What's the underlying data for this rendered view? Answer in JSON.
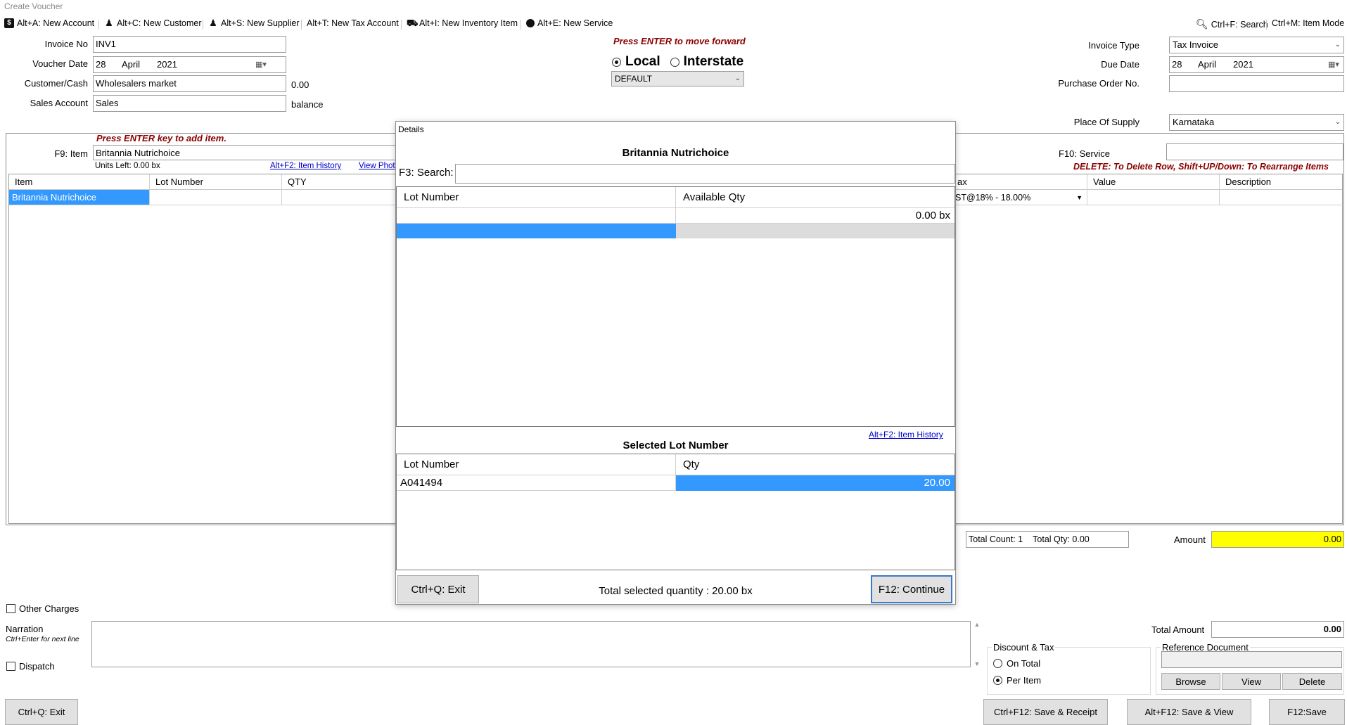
{
  "window": {
    "title": "Create Voucher"
  },
  "toolbar": {
    "items": [
      {
        "icon": "account-icon",
        "label": "Alt+A: New Account"
      },
      {
        "icon": "customer-icon",
        "label": "Alt+C: New Customer"
      },
      {
        "icon": "supplier-icon",
        "label": "Alt+S: New Supplier"
      },
      {
        "icon": "",
        "label": "Alt+T: New Tax Account"
      },
      {
        "icon": "inventory-icon",
        "label": "Alt+I: New Inventory Item"
      },
      {
        "icon": "service-icon",
        "label": "Alt+E: New Service"
      }
    ],
    "search": "Ctrl+F: Search",
    "item_mode": "Ctrl+M: Item Mode"
  },
  "header": {
    "invoice_no_label": "Invoice No",
    "invoice_no": "INV1",
    "voucher_date_label": "Voucher Date",
    "voucher_date": {
      "day": "28",
      "month": "April",
      "year": "2021"
    },
    "customer_label": "Customer/Cash",
    "customer": "Wholesalers market",
    "customer_balance": "0.00",
    "sales_account_label": "Sales Account",
    "sales_account": "Sales",
    "balance_label": "balance",
    "enter_hint": "Press ENTER to move forward",
    "local_label": "Local",
    "interstate_label": "Interstate",
    "price_list": "DEFAULT",
    "invoice_type_label": "Invoice Type",
    "invoice_type": "Tax Invoice",
    "due_date_label": "Due Date",
    "due_date": {
      "day": "28",
      "month": "April",
      "year": "2021"
    },
    "po_label": "Purchase Order No.",
    "po_value": "",
    "place_of_supply_label": "Place Of Supply",
    "place_of_supply": "Karnataka"
  },
  "items_panel": {
    "add_hint": "Press ENTER key to add item.",
    "item_label": "F9: Item",
    "item_value": "Britannia Nutrichoice",
    "units_left": "Units Left: 0.00 bx",
    "item_history_link": "Alt+F2: Item History",
    "view_photo_link": "View Phot",
    "service_label": "F10: Service",
    "delete_hint": "DELETE: To Delete Row, Shift+UP/Down: To Rearrange Items",
    "columns_left": [
      "Item",
      "Lot Number",
      "QTY"
    ],
    "columns_right": [
      "ax",
      "Value",
      "Description"
    ],
    "rows": [
      {
        "item": "Britannia Nutrichoice",
        "tax": "ST@18% - 18.00%",
        "value": "",
        "description": ""
      }
    ]
  },
  "totals": {
    "total_count": "Total Count: 1",
    "total_qty": "Total Qty: 0.00",
    "amount_label": "Amount",
    "amount": "0.00",
    "total_amount_label": "Total Amount",
    "total_amount": "0.00"
  },
  "footer": {
    "other_charges": "Other Charges",
    "narration_label": "Narration",
    "narration_hint": "Ctrl+Enter for next line",
    "dispatch": "Dispatch",
    "discount_tax_label": "Discount & Tax",
    "on_total": "On Total",
    "per_item": "Per Item",
    "reference_document_label": "Reference Document",
    "browse": "Browse",
    "view": "View",
    "delete": "Delete",
    "exit_button": "Ctrl+Q: Exit",
    "save_receipt_button": "Ctrl+F12: Save & Receipt",
    "save_view_button": "Alt+F12: Save & View",
    "save_button": "F12:Save"
  },
  "modal": {
    "title": "Details",
    "heading": "Britannia Nutrichoice",
    "search_label": "F3: Search:",
    "search_value": "",
    "available_columns": [
      "Lot Number",
      "Available Qty"
    ],
    "available_rows": [
      {
        "lot": "",
        "qty": "0.00 bx"
      }
    ],
    "item_history_link": "Alt+F2: Item History",
    "selected_heading": "Selected Lot Number",
    "selected_columns": [
      "Lot Number",
      "Qty"
    ],
    "selected_rows": [
      {
        "lot": "A041494",
        "qty": "20.00"
      }
    ],
    "exit_button": "Ctrl+Q: Exit",
    "total_selected": "Total selected quantity : 20.00 bx",
    "continue_button": "F12: Continue"
  },
  "colors": {
    "selection": "#3399ff",
    "amount_highlight": "#ffff00",
    "hint_red": "#8b0000",
    "link_blue": "#0000cc"
  }
}
